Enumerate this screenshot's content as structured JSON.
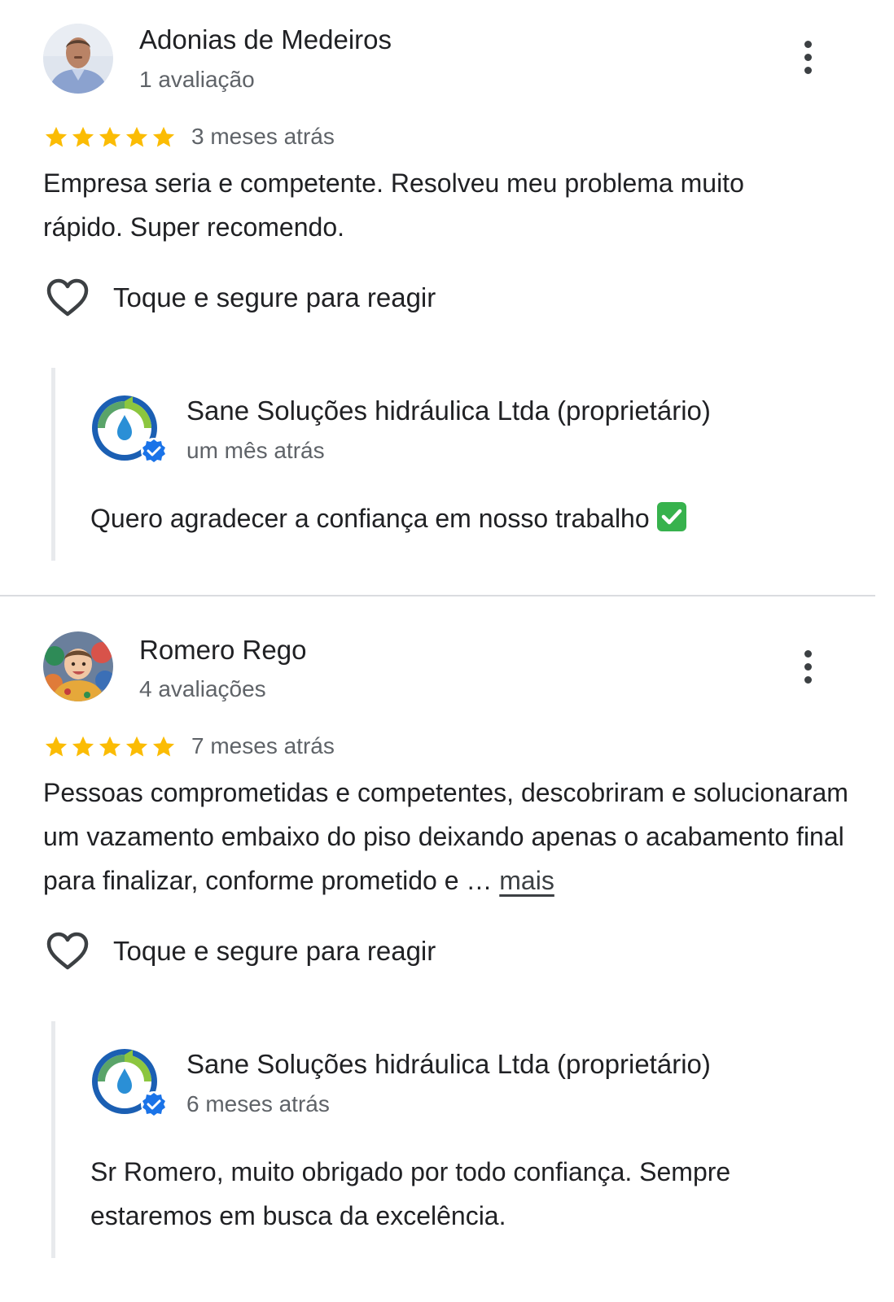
{
  "reviews": [
    {
      "author": "Adonias de Medeiros",
      "author_meta": "1 avaliação",
      "rating": 5,
      "date": "3 meses atrás",
      "text": "Empresa seria e competente.  Resolveu meu problema muito rápido. Super recomendo.",
      "react_label": "Toque e segure para reagir",
      "reply": {
        "owner": "Sane Soluções hidráulica Ltda (proprietário)",
        "date": "um mês atrás",
        "text": "Quero agradecer a confiança em nosso trabalho"
      }
    },
    {
      "author": "Romero Rego",
      "author_meta": "4 avaliações",
      "rating": 5,
      "date": "7 meses atrás",
      "text": "Pessoas comprometidas e competentes, descobriram e solucionaram um vazamento embaixo do piso deixando apenas o acabamento final para finalizar, conforme prometido e … ",
      "more_link": "mais",
      "react_label": "Toque e segure para reagir",
      "reply": {
        "owner": "Sane Soluções hidráulica Ltda (proprietário)",
        "date": "6 meses atrás",
        "text": "Sr Romero, muito obrigado por todo confiança. Sempre estaremos em busca da excelência."
      }
    }
  ],
  "icons": {
    "star": "star-icon",
    "more": "more-vert-icon",
    "heart": "heart-outline-icon",
    "verified": "verified-badge-icon",
    "check": "check-mark-emoji"
  },
  "colors": {
    "star": "#fbbc04",
    "verified": "#1a73e8",
    "check": "#37b24d"
  }
}
